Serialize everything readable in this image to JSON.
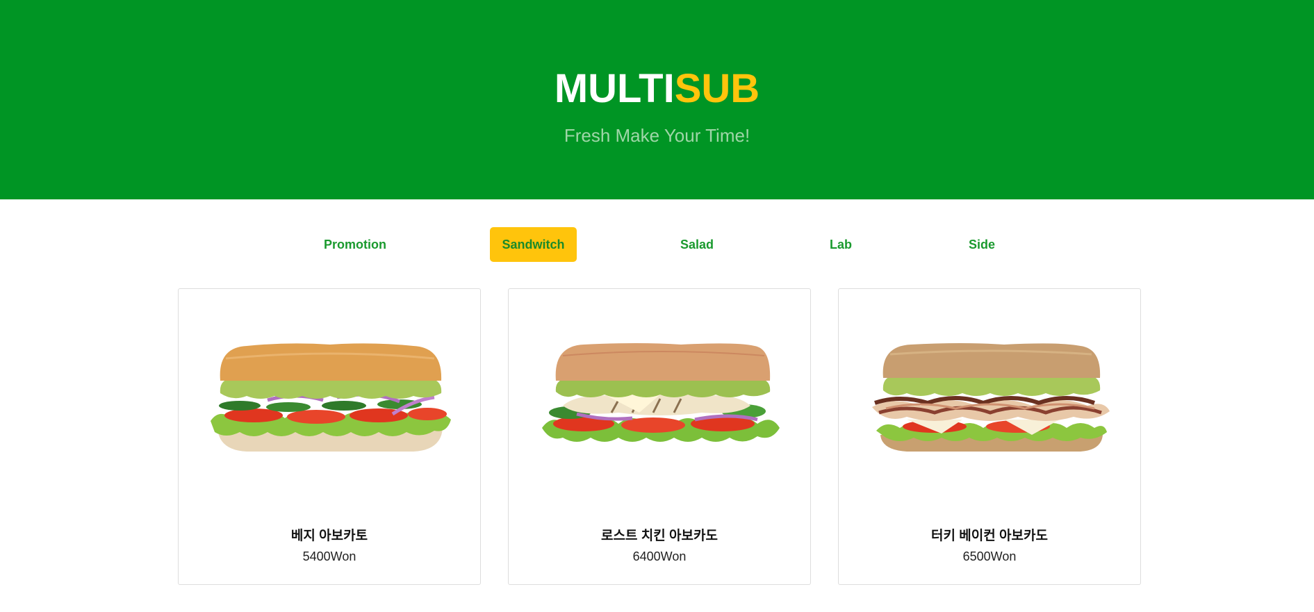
{
  "header": {
    "brand_part1": "MULTI",
    "brand_part2": "SUB",
    "tagline": "Fresh Make Your Time!"
  },
  "colors": {
    "primary_green": "#009524",
    "accent_yellow": "#ffc40c",
    "tab_text": "#1a9a2e"
  },
  "tabs": [
    {
      "label": "Promotion",
      "active": false
    },
    {
      "label": "Sandwitch",
      "active": true
    },
    {
      "label": "Salad",
      "active": false
    },
    {
      "label": "Lab",
      "active": false
    },
    {
      "label": "Side",
      "active": false
    }
  ],
  "products": [
    {
      "name": "베지 아보카토",
      "price": "5400Won",
      "image": "veggie-avocado-sandwich"
    },
    {
      "name": "로스트 치킨 아보카도",
      "price": "6400Won",
      "image": "roast-chicken-avocado-sandwich"
    },
    {
      "name": "터키 베이컨 아보카도",
      "price": "6500Won",
      "image": "turkey-bacon-avocado-sandwich"
    }
  ]
}
